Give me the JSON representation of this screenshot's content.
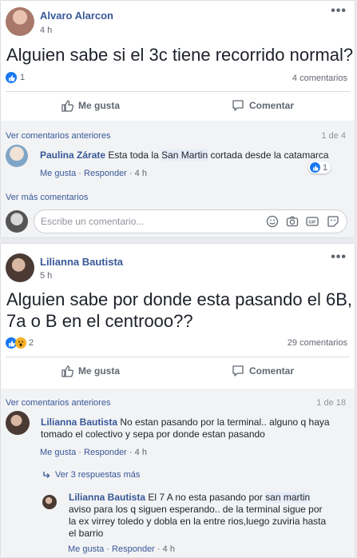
{
  "post1": {
    "author": "Alvaro Alarcon",
    "time": "4 h",
    "text": "Alguien sabe si el 3c tiene recorrido normal?",
    "reactions_count": "1",
    "comments_count": "4 comentarios",
    "like_label": "Me gusta",
    "comment_label": "Comentar",
    "prev_comments": "Ver comentarios anteriores",
    "prev_counter": "1 de 4",
    "comment": {
      "author": "Paulina Zárate",
      "text_before": "Esta toda la",
      "highlight": "San Martin",
      "text_after": "cortada desde la catamarca",
      "like": "Me gusta",
      "reply": "Responder",
      "time": "4 h",
      "likes": "1"
    },
    "more_comments": "Ver más comentarios",
    "input_placeholder": "Escribe un comentario..."
  },
  "post2": {
    "author": "Lilianna Bautista",
    "time": "5 h",
    "text_line1": "Alguien sabe por donde esta pasando el 6B,",
    "text_line2": "7a o B en el centrooo??",
    "reactions_count": "2",
    "comments_count": "29 comentarios",
    "like_label": "Me gusta",
    "comment_label": "Comentar",
    "prev_comments": "Ver comentarios anteriores",
    "prev_counter": "1 de 18",
    "comment": {
      "author": "Lilianna Bautista",
      "text_line1": "No estan pasando por la terminal.. alguno q haya",
      "text_line2": "tomado el colectivo y sepa por donde estan pasando",
      "like": "Me gusta",
      "reply": "Responder",
      "time": "4 h"
    },
    "view_replies": "Ver 3 respuestas más",
    "reply": {
      "author": "Lilianna Bautista",
      "text_start": "El 7 A no esta pasando por",
      "highlight": "san martin",
      "text_line2": "aviso para los q siguen esperando.. de la terminal sigue por",
      "text_line3": "la ex virrey toledo y dobla en la entre rios,luego zuviria hasta",
      "text_line4": "el barrio",
      "like": "Me gusta",
      "reply": "Responder",
      "time": "4 h"
    }
  },
  "colors": {
    "link": "#385898",
    "like_blue": "#1877f2",
    "wow_yellow": "#f7b125"
  },
  "icons": [
    "avatar",
    "more-dots-icon",
    "like-reaction-icon",
    "wow-reaction-icon",
    "thumbs-up-icon",
    "comment-icon",
    "emoji-icon",
    "camera-icon",
    "gif-icon",
    "sticker-icon",
    "reply-arrow-icon"
  ]
}
